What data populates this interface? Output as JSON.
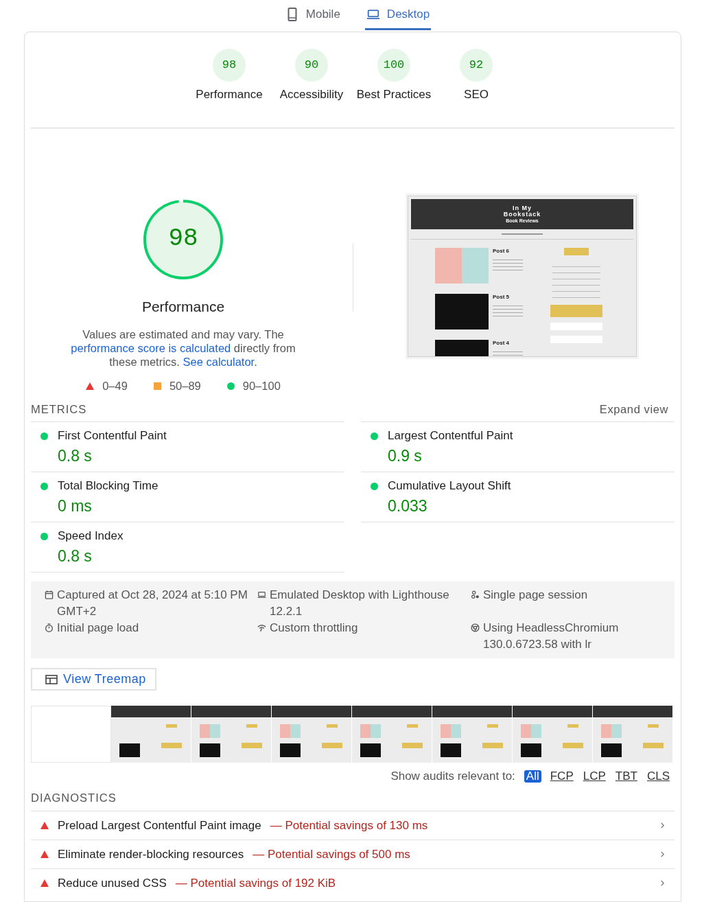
{
  "tabs": [
    {
      "label": "Mobile",
      "kind": "phone",
      "selected": false
    },
    {
      "label": "Desktop",
      "kind": "laptop",
      "selected": true
    }
  ],
  "categories": [
    {
      "score": "98",
      "label": "Performance"
    },
    {
      "score": "90",
      "label": "Accessibility"
    },
    {
      "score": "100",
      "label": "Best Practices"
    },
    {
      "score": "92",
      "label": "SEO"
    }
  ],
  "performance": {
    "score": "98",
    "level": 0.98,
    "title": "Performance",
    "description": [
      {
        "kind": "text",
        "text": "Values are estimated and may vary. The "
      },
      {
        "kind": "link",
        "text": "performance score is calculated"
      },
      {
        "kind": "text",
        "text": " directly from these metrics. "
      },
      {
        "kind": "link",
        "text": "See calculator."
      }
    ],
    "legend": [
      {
        "kind": "triangle",
        "label": "0–49"
      },
      {
        "kind": "square",
        "label": "50–89"
      },
      {
        "kind": "circle",
        "label": "90–100"
      }
    ]
  },
  "screenshot": {
    "site_title": "In My Bookstack",
    "site_subtitle": "Book Reviews",
    "posts": [
      "Post 6",
      "Post 5",
      "Post 4"
    ]
  },
  "metrics": {
    "title": "METRICS",
    "toggle": "Expand view",
    "items": [
      {
        "name": "First Contentful Paint",
        "value": "0.8 s",
        "color": "#0cce6b"
      },
      {
        "name": "Largest Contentful Paint",
        "value": "0.9 s",
        "color": "#0cce6b"
      },
      {
        "name": "Total Blocking Time",
        "value": "0 ms",
        "color": "#0cce6b"
      },
      {
        "name": "Cumulative Layout Shift",
        "value": "0.033",
        "color": "#0cce6b"
      },
      {
        "name": "Speed Index",
        "value": "0.8 s",
        "color": "#0cce6b"
      }
    ]
  },
  "environment": [
    {
      "kind": "calendar",
      "text": "Captured at Oct 28, 2024 at 5:10 PM GMT+2"
    },
    {
      "kind": "laptop",
      "text": "Emulated Desktop with Lighthouse 12.2.1"
    },
    {
      "kind": "people",
      "text": "Single page session"
    },
    {
      "kind": "timer",
      "text": "Initial page load"
    },
    {
      "kind": "signal",
      "text": "Custom throttling"
    },
    {
      "kind": "browser",
      "text": "Using HeadlessChromium 130.0.6723.58 with lr"
    }
  ],
  "treemap_button": "View Treemap",
  "filter": {
    "label": "Show audits relevant to:",
    "options": [
      {
        "label": "All",
        "selected": true
      },
      {
        "label": "FCP",
        "selected": false
      },
      {
        "label": "LCP",
        "selected": false
      },
      {
        "label": "TBT",
        "selected": false
      },
      {
        "label": "CLS",
        "selected": false
      }
    ]
  },
  "diagnostics": {
    "title": "DIAGNOSTICS",
    "items": [
      {
        "title": "Preload Largest Contentful Paint image",
        "savings": "— Potential savings of 130 ms"
      },
      {
        "title": "Eliminate render-blocking resources",
        "savings": "— Potential savings of 500 ms"
      },
      {
        "title": "Reduce unused CSS",
        "savings": "— Potential savings of 192 KiB"
      }
    ]
  }
}
